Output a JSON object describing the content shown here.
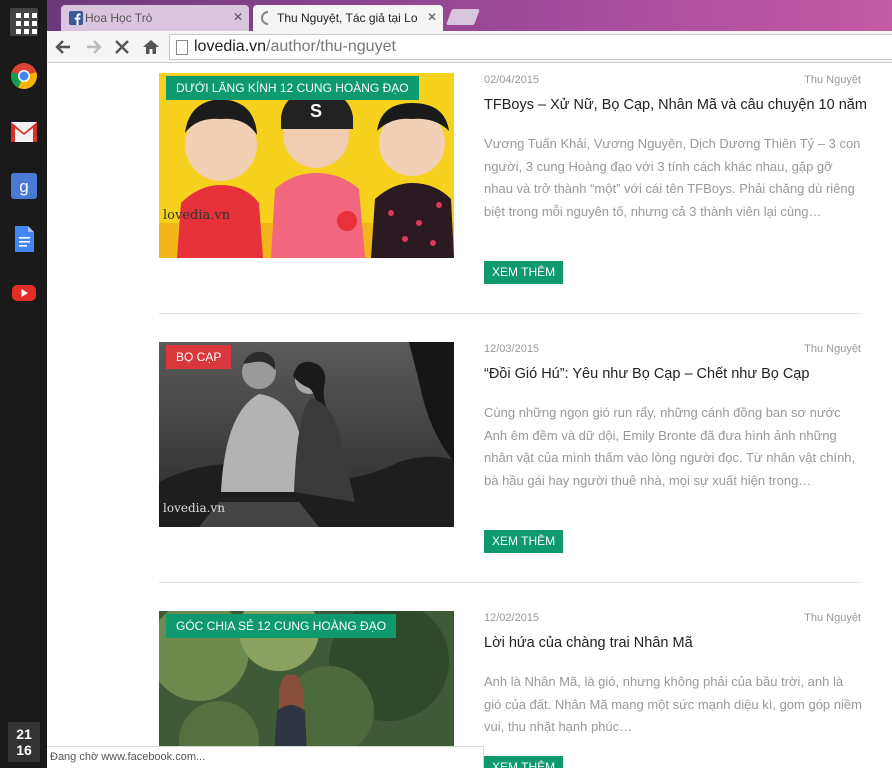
{
  "shelf": {
    "apps": [
      "chrome",
      "gmail",
      "google-search",
      "google-docs",
      "youtube"
    ],
    "clock_hour": "21",
    "clock_minute": "16"
  },
  "tabs": [
    {
      "label": "Hoa Học Trò",
      "favicon": "facebook-icon"
    },
    {
      "label": "Thu Nguyệt, Tác giả tại Lo",
      "favicon": "loading-icon"
    }
  ],
  "toolbar": {
    "url_host": "lovedia.vn",
    "url_path": "/author/thu-nguyet"
  },
  "posts": [
    {
      "category": "DƯỚI LĂNG KÍNH 12 CUNG HOÀNG ĐẠO",
      "category_color": "#0e9a6e",
      "date": "02/04/2015",
      "author": "Thu Nguyệt",
      "title": "TFBoys – Xử Nữ, Bọ Cạp, Nhân Mã và câu chuyện 10 năm",
      "excerpt": "Vương Tuấn Khải, Vương Nguyên, Dịch Dương Thiên Tỷ – 3 con người, 3 cung Hoàng đạo với 3 tính cách khác nhau, gặp gỡ nhau và trở thành “một” với cái tên TFBoys. Phải chăng dù riêng biệt trong mỗi nguyên tố, nhưng cả 3 thành viên lại cùng…",
      "more": "XEM THÊM",
      "image_watermark": "lovedia.vn"
    },
    {
      "category": "BỌ CẠP",
      "category_color": "#d9363e",
      "date": "12/03/2015",
      "author": "Thu Nguyệt",
      "title": "“Đồi Gió Hú”: Yêu như Bọ Cạp – Chết như Bọ Cạp",
      "excerpt": "Cùng những ngọn gió run rẩy, những cánh đồng ban sơ nước Anh êm đềm và dữ dội, Emily Bronte đã đưa hình ảnh những nhân vật của mình thấm vào lòng người đọc. Từ nhân vật chính, bà hầu gái hay người thuê nhà, mọi sự xuất hiện trong…",
      "more": "XEM THÊM",
      "image_watermark": "lovedia.vn"
    },
    {
      "category": "GÓC CHIA SẺ 12 CUNG HOÀNG ĐẠO",
      "category_color": "#0e9a6e",
      "date": "12/02/2015",
      "author": "Thu Nguyệt",
      "title": "Lời hứa của chàng trai Nhân Mã",
      "excerpt": "Anh là Nhân Mã, là gió, nhưng không phải của bầu trời, anh là gió của đất. Nhân Mã mang một sức mạnh diệu kì, gom góp niềm vui, thu nhặt hạnh phúc…",
      "more": "XEM THÊM"
    }
  ],
  "status": "Đang chờ www.facebook.com..."
}
